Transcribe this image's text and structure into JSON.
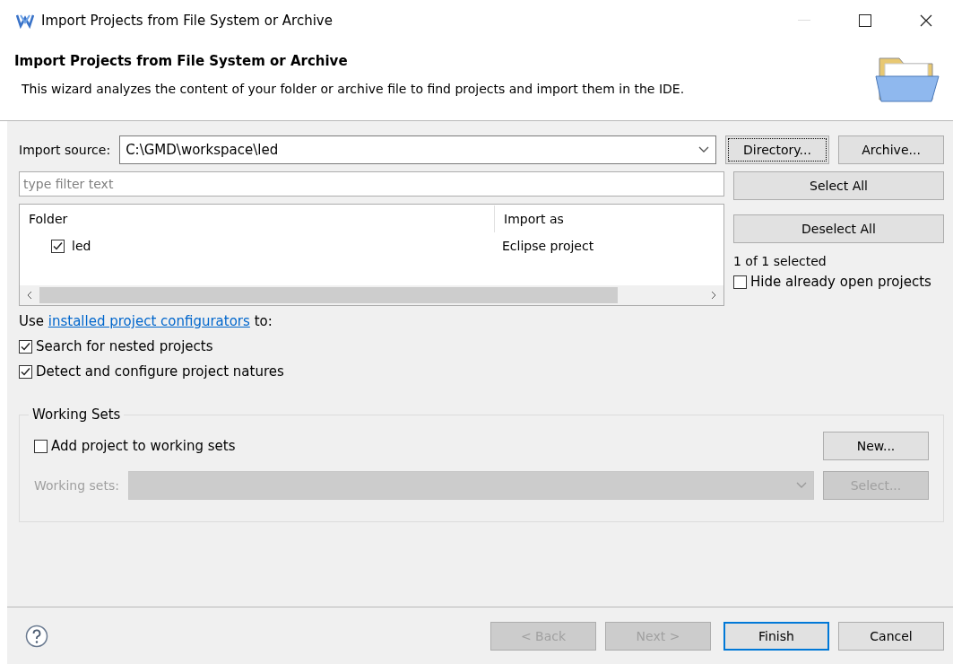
{
  "window": {
    "title": "Import Projects from File System or Archive"
  },
  "header": {
    "title": "Import Projects from File System or Archive",
    "description": "This wizard analyzes the content of your folder or archive file to find projects and import them in the IDE."
  },
  "import_source": {
    "label": "Import source:",
    "value": "C:\\GMD\\workspace\\led"
  },
  "source_buttons": [
    {
      "label": "Directory...",
      "focused": true
    },
    {
      "label": "Archive...",
      "focused": false
    }
  ],
  "filter": {
    "placeholder": "type filter text"
  },
  "table": {
    "columns": [
      "Folder",
      "Import as"
    ],
    "rows": [
      {
        "folder": "led",
        "import_as": "Eclipse project",
        "checked": true
      }
    ]
  },
  "side_buttons": [
    "Select All",
    "Deselect All"
  ],
  "selection_count": "1 of 1 selected",
  "hide_open": {
    "label": "Hide already open projects",
    "checked": false
  },
  "configurators": {
    "prefix": "Use ",
    "link": "installed project configurators",
    "suffix": " to:"
  },
  "options": [
    {
      "label": "Search for nested projects",
      "checked": true
    },
    {
      "label": "Detect and configure project natures",
      "checked": true
    }
  ],
  "working_sets": {
    "title": "Working Sets",
    "add": {
      "label": "Add project to working sets",
      "checked": false
    },
    "new_button": "New...",
    "sets_label": "Working sets:",
    "disabled": true,
    "select_button": "Select..."
  },
  "footer": {
    "buttons": [
      {
        "label": "< Back",
        "disabled": true,
        "default": false
      },
      {
        "label": "Next >",
        "disabled": true,
        "default": false
      },
      {
        "label": "Finish",
        "disabled": false,
        "default": true
      },
      {
        "label": "Cancel",
        "disabled": false,
        "default": false
      }
    ]
  }
}
